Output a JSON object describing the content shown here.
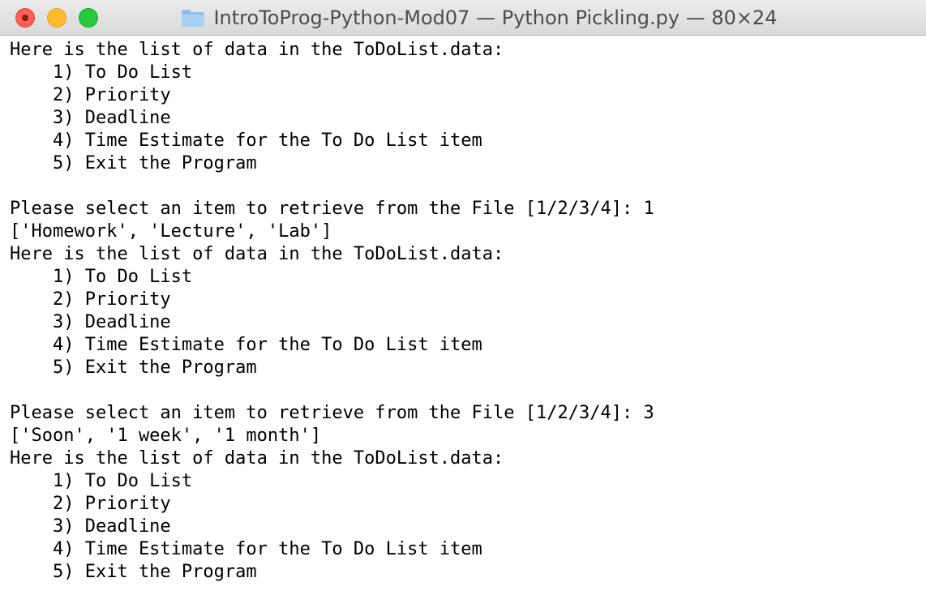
{
  "window": {
    "title": "IntroToProg-Python-Mod07 — Python Pickling.py — 80×24",
    "folder_icon": "folder-icon",
    "colors": {
      "close": "#fd5f57",
      "minimize": "#febc2e",
      "zoom": "#28c840",
      "folder": "#8fc1e8"
    }
  },
  "terminal": {
    "lines": [
      "Here is the list of data in the ToDoList.data:",
      "    1) To Do List",
      "    2) Priority",
      "    3) Deadline",
      "    4) Time Estimate for the To Do List item",
      "    5) Exit the Program",
      "",
      "Please select an item to retrieve from the File [1/2/3/4]: 1",
      "['Homework', 'Lecture', 'Lab']",
      "Here is the list of data in the ToDoList.data:",
      "    1) To Do List",
      "    2) Priority",
      "    3) Deadline",
      "    4) Time Estimate for the To Do List item",
      "    5) Exit the Program",
      "",
      "Please select an item to retrieve from the File [1/2/3/4]: 3",
      "['Soon', '1 week', '1 month']",
      "Here is the list of data in the ToDoList.data:",
      "    1) To Do List",
      "    2) Priority",
      "    3) Deadline",
      "    4) Time Estimate for the To Do List item",
      "    5) Exit the Program"
    ]
  }
}
